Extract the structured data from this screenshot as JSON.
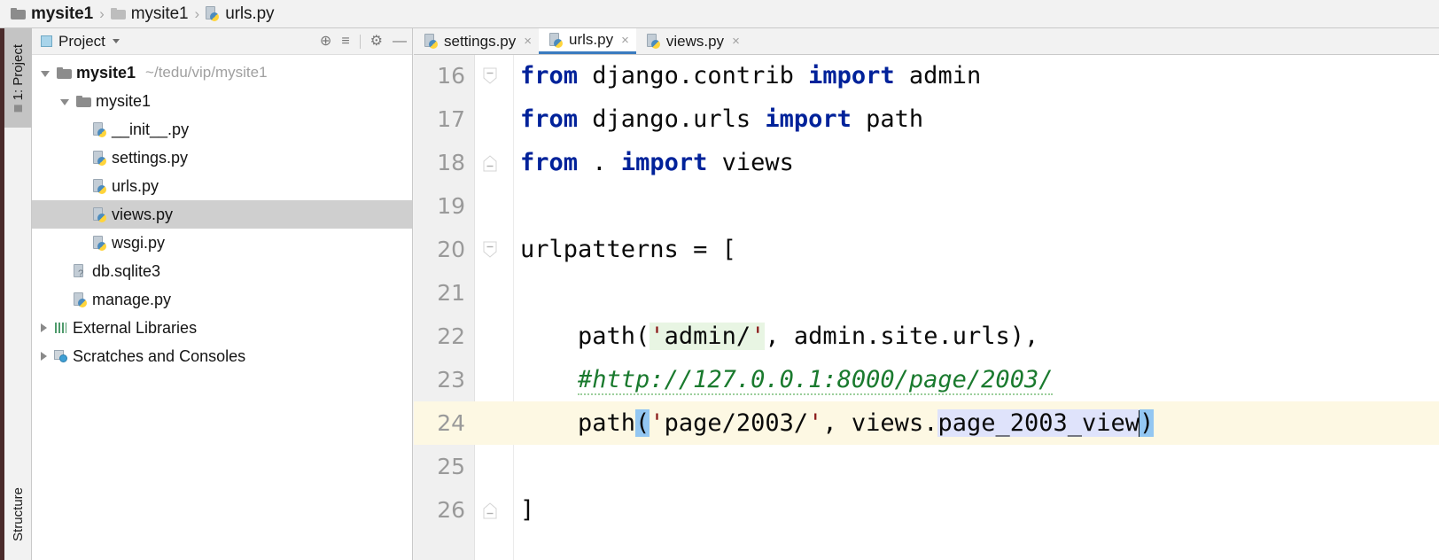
{
  "breadcrumb": {
    "items": [
      {
        "label": "mysite1",
        "icon": "folder-icon",
        "bold": true
      },
      {
        "label": "mysite1",
        "icon": "folder-icon",
        "bold": false
      },
      {
        "label": "urls.py",
        "icon": "python-file-icon",
        "bold": false
      }
    ],
    "separator": "›"
  },
  "tool_strip": {
    "project_label": "1: Project",
    "structure_label": "Structure"
  },
  "project_panel": {
    "title": "Project",
    "tools": {
      "locate_icon": "⊕",
      "collapse_all_icon": "≡",
      "settings_icon": "⚙",
      "hide_icon": "—"
    },
    "tree": [
      {
        "label": "mysite1",
        "path": "~/tedu/vip/mysite1",
        "icon": "folder-icon",
        "indent": 0,
        "twisty": "open",
        "bold": true,
        "selected": false
      },
      {
        "label": "mysite1",
        "path": "",
        "icon": "folder-icon",
        "indent": 1,
        "twisty": "open",
        "bold": false,
        "selected": false
      },
      {
        "label": "__init__.py",
        "path": "",
        "icon": "python-file-icon",
        "indent": 2,
        "twisty": "none",
        "bold": false,
        "selected": false
      },
      {
        "label": "settings.py",
        "path": "",
        "icon": "python-file-icon",
        "indent": 2,
        "twisty": "none",
        "bold": false,
        "selected": false
      },
      {
        "label": "urls.py",
        "path": "",
        "icon": "python-file-icon",
        "indent": 2,
        "twisty": "none",
        "bold": false,
        "selected": false
      },
      {
        "label": "views.py",
        "path": "",
        "icon": "python-file-icon",
        "indent": 2,
        "twisty": "none",
        "bold": false,
        "selected": true
      },
      {
        "label": "wsgi.py",
        "path": "",
        "icon": "python-file-icon",
        "indent": 2,
        "twisty": "none",
        "bold": false,
        "selected": false
      },
      {
        "label": "db.sqlite3",
        "path": "",
        "icon": "database-file-icon",
        "indent": 1,
        "twisty": "none",
        "bold": false,
        "selected": false
      },
      {
        "label": "manage.py",
        "path": "",
        "icon": "python-file-icon",
        "indent": 1,
        "twisty": "none",
        "bold": false,
        "selected": false
      },
      {
        "label": "External Libraries",
        "path": "",
        "icon": "library-icon",
        "indent": 0,
        "twisty": "closed",
        "bold": false,
        "selected": false
      },
      {
        "label": "Scratches and Consoles",
        "path": "",
        "icon": "scratch-icon",
        "indent": 0,
        "twisty": "closed",
        "bold": false,
        "selected": false
      }
    ]
  },
  "editor": {
    "tabs": [
      {
        "label": "settings.py",
        "active": false,
        "close_icon": "×"
      },
      {
        "label": "urls.py",
        "active": true,
        "close_icon": "×"
      },
      {
        "label": "views.py",
        "active": false,
        "close_icon": "×"
      }
    ],
    "current_line": 24,
    "lines": [
      {
        "number": "16",
        "fold": "start",
        "text": "from django.contrib import admin"
      },
      {
        "number": "17",
        "fold": "none",
        "text": "from django.urls import path"
      },
      {
        "number": "18",
        "fold": "end",
        "text": "from . import views"
      },
      {
        "number": "19",
        "fold": "none",
        "text": ""
      },
      {
        "number": "20",
        "fold": "start",
        "text": "urlpatterns = ["
      },
      {
        "number": "21",
        "fold": "none",
        "text": ""
      },
      {
        "number": "22",
        "fold": "none",
        "text": "    path('admin/', admin.site.urls),"
      },
      {
        "number": "23",
        "fold": "none",
        "text": "    #http://127.0.0.1:8000/page/2003/"
      },
      {
        "number": "24",
        "fold": "none",
        "text": "    path('page/2003/', views.page_2003_view)"
      },
      {
        "number": "25",
        "fold": "none",
        "text": ""
      },
      {
        "number": "26",
        "fold": "end",
        "text": "]"
      }
    ],
    "selection_text": "page_2003_view",
    "colors": {
      "keyword": "#00229a",
      "comment": "#1a7a2e",
      "string_quote": "#8b1a1a",
      "string_highlight_bg": "#e8f5e3",
      "selection_bg": "#dfe3fb",
      "brace_match_bg": "#93c7f2",
      "current_line_bg": "#fdf8e3",
      "active_tab_underline": "#3a7bbf"
    }
  }
}
